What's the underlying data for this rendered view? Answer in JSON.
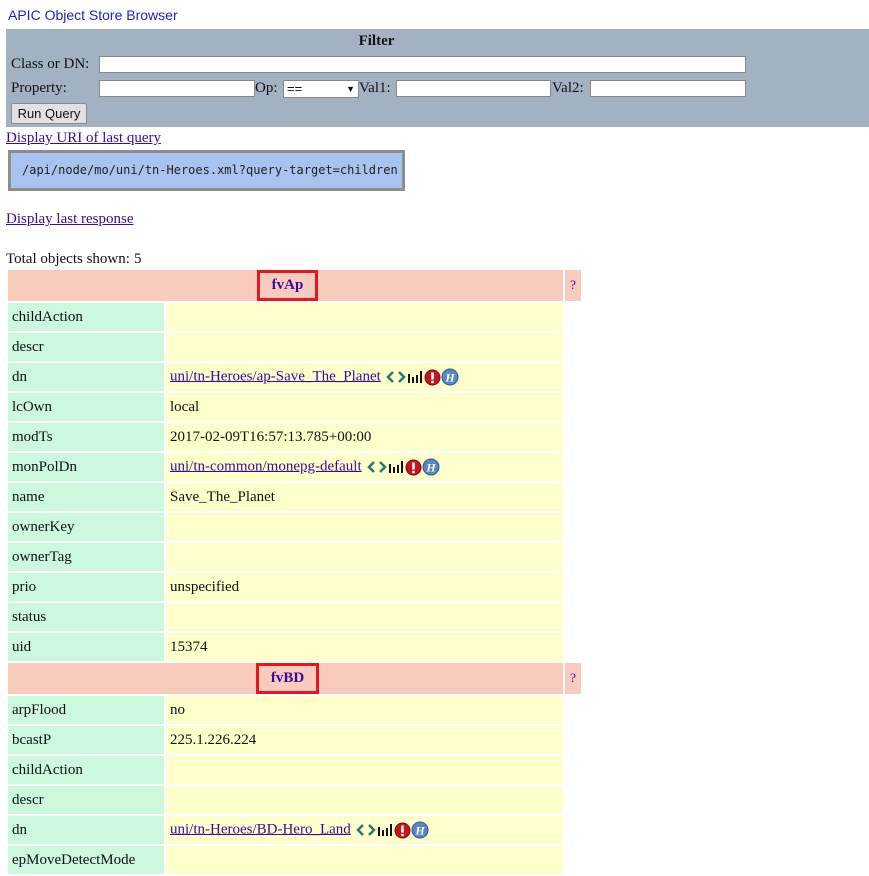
{
  "app": {
    "title": "APIC Object Store Browser"
  },
  "filter": {
    "title": "Filter",
    "class_or_dn_label": "Class or DN:",
    "property_label": "Property:",
    "op_label": "Op:",
    "op_value": "==",
    "val1_label": "Val1:",
    "val2_label": "Val2:",
    "run_button": "Run Query"
  },
  "links": {
    "display_uri": "Display URI of last query",
    "display_response": "Display last response"
  },
  "query_uri": "/api/node/mo/uni/tn-Heroes.xml?query-target=children",
  "total": {
    "label": "Total objects shown:",
    "count": "5"
  },
  "objects": [
    {
      "class": "fvAp",
      "help": "?",
      "props": [
        {
          "name": "childAction",
          "value": ""
        },
        {
          "name": "descr",
          "value": ""
        },
        {
          "name": "dn",
          "value": "uni/tn-Heroes/ap-Save_The_Planet",
          "link": true
        },
        {
          "name": "lcOwn",
          "value": "local"
        },
        {
          "name": "modTs",
          "value": "2017-02-09T16:57:13.785+00:00"
        },
        {
          "name": "monPolDn",
          "value": "uni/tn-common/monepg-default",
          "link": true
        },
        {
          "name": "name",
          "value": "Save_The_Planet"
        },
        {
          "name": "ownerKey",
          "value": ""
        },
        {
          "name": "ownerTag",
          "value": ""
        },
        {
          "name": "prio",
          "value": "unspecified"
        },
        {
          "name": "status",
          "value": ""
        },
        {
          "name": "uid",
          "value": "15374"
        }
      ]
    },
    {
      "class": "fvBD",
      "help": "?",
      "props": [
        {
          "name": "arpFlood",
          "value": "no"
        },
        {
          "name": "bcastP",
          "value": "225.1.226.224"
        },
        {
          "name": "childAction",
          "value": ""
        },
        {
          "name": "descr",
          "value": ""
        },
        {
          "name": "dn",
          "value": "uni/tn-Heroes/BD-Hero_Land",
          "link": true
        },
        {
          "name": "epMoveDetectMode",
          "value": ""
        }
      ]
    }
  ],
  "dn_icons": [
    "chevron-left-icon",
    "chevron-right-icon",
    "stats-icon",
    "faults-icon",
    "history-icon"
  ],
  "colors": {
    "filter_bg": "#a2b2c3",
    "header_bg": "#f8cbbc",
    "prop_name_bg": "#ccf8dd",
    "prop_value_bg": "#ffffcc",
    "uri_box_bg": "#a9c3ee",
    "highlight_border": "#e3171f",
    "link": "#3a0a9a"
  }
}
